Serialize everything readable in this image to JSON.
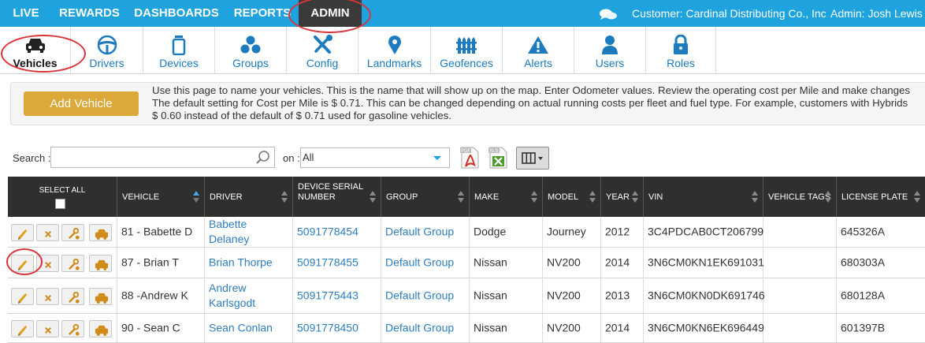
{
  "top_nav": {
    "items": [
      "LIVE",
      "REWARDS",
      "DASHBOARDS",
      "REPORTS",
      "ADMIN"
    ],
    "active": "ADMIN",
    "customer": "Customer: Cardinal Distributing Co., Inc",
    "admin_user": "Admin: Josh Lewis"
  },
  "sub_nav": {
    "items": [
      {
        "label": "Vehicles",
        "icon": "car-icon"
      },
      {
        "label": "Drivers",
        "icon": "steering-wheel-icon"
      },
      {
        "label": "Devices",
        "icon": "device-icon"
      },
      {
        "label": "Groups",
        "icon": "groups-icon"
      },
      {
        "label": "Config",
        "icon": "tools-icon"
      },
      {
        "label": "Landmarks",
        "icon": "map-pin-icon"
      },
      {
        "label": "Geofences",
        "icon": "fence-icon"
      },
      {
        "label": "Alerts",
        "icon": "warning-icon"
      },
      {
        "label": "Users",
        "icon": "user-icon"
      },
      {
        "label": "Roles",
        "icon": "lock-icon"
      }
    ],
    "active": "Vehicles"
  },
  "info": {
    "add_button": "Add Vehicle",
    "lines": [
      "Use this page to name your vehicles. This is the name that will show up on the map. Enter Odometer values. Review the operating cost per Mile and make changes",
      "The default setting for Cost per Mile is $ 0.71. This can be changed depending on actual running costs per fleet and fuel type. For example, customers with Hybrids",
      "$ 0.60 instead of the default of $ 0.71 used for gasoline vehicles."
    ]
  },
  "search": {
    "label": "Search :",
    "value": "",
    "on_label": "on :",
    "on_value": "All",
    "pdf_label": "PDF",
    "xls_label": "XLS"
  },
  "table": {
    "select_all": "SELECT ALL",
    "columns": [
      "VEHICLE",
      "DRIVER",
      "DEVICE SERIAL NUMBER",
      "GROUP",
      "MAKE",
      "MODEL",
      "YEAR",
      "VIN",
      "VEHICLE TAGS",
      "LICENSE PLATE"
    ],
    "rows": [
      {
        "vehicle": "81 - Babette D",
        "driver": "Babette Delaney",
        "serial": "5091778454",
        "group": "Default Group",
        "make": "Dodge",
        "model": "Journey",
        "year": "2012",
        "vin": "3C4PDCAB0CT206799",
        "tags": "",
        "plate": "645326A"
      },
      {
        "vehicle": "87 - Brian T",
        "driver": "Brian Thorpe",
        "serial": "5091778455",
        "group": "Default Group",
        "make": "Nissan",
        "model": "NV200",
        "year": "2014",
        "vin": "3N6CM0KN1EK691031",
        "tags": "",
        "plate": "680303A"
      },
      {
        "vehicle": "88 -Andrew K",
        "driver": "Andrew Karlsgodt",
        "serial": "5091775443",
        "group": "Default Group",
        "make": "Nissan",
        "model": "NV200",
        "year": "2013",
        "vin": "3N6CM0KN0DK691746",
        "tags": "",
        "plate": "680128A"
      },
      {
        "vehicle": "90 - Sean C",
        "driver": "Sean Conlan",
        "serial": "5091778450",
        "group": "Default Group",
        "make": "Nissan",
        "model": "NV200",
        "year": "2014",
        "vin": "3N6CM0KN6EK696449",
        "tags": "",
        "plate": "601397B"
      }
    ]
  },
  "colors": {
    "top_bar": "#1fa3df",
    "active_tab": "#3a3a3a",
    "link": "#2f7ec0",
    "add_button": "#dca83a",
    "annotation": "#d9343b"
  }
}
